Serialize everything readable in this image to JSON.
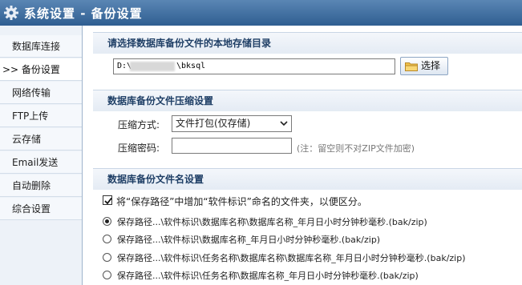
{
  "window": {
    "title": "系统设置 - 备份设置"
  },
  "sidebar": {
    "items": [
      {
        "label": "数据库连接"
      },
      {
        "label": ">> 备份设置"
      },
      {
        "label": "网络传输"
      },
      {
        "label": "FTP上传"
      },
      {
        "label": "云存储"
      },
      {
        "label": "Email发送"
      },
      {
        "label": "自动删除"
      },
      {
        "label": "综合设置"
      }
    ]
  },
  "storage": {
    "heading": "请选择数据库备份文件的本地存储目录",
    "path_prefix": "D:\\",
    "path_suffix": "\\bksql",
    "choose_button": "选择"
  },
  "compression": {
    "heading": "数据库备份文件压缩设置",
    "method_label": "压缩方式:",
    "method_value": "文件打包(仅存储)",
    "password_label": "压缩密码:",
    "password_value": "",
    "password_hint": "(注：留空则不对ZIP文件加密)"
  },
  "filename": {
    "heading": "数据库备份文件名设置",
    "folder_checkbox_label": "将“保存路径”中增加“软件标识”命名的文件夹，以便区分。",
    "folder_checkbox_checked": true,
    "selected_option": 0,
    "options": [
      "保存路径...\\软件标识\\数据库名称\\数据库名称_年月日小时分钟秒毫秒.(bak/zip)",
      "保存路径...\\软件标识\\数据库名称_年月日小时分钟秒毫秒.(bak/zip)",
      "保存路径...\\软件标识\\任务名称\\数据库名称\\数据库名称_年月日小时分钟秒毫秒.(bak/zip)",
      "保存路径...\\软件标识\\任务名称\\数据库名称_年月日小时分钟秒毫秒.(bak/zip)"
    ]
  },
  "colors": {
    "titlebar": "#3d6a9c",
    "section_text": "#1f3f66",
    "sidebar_bg": "#edf2f8"
  },
  "icons": {
    "title": "gear-icon",
    "choose": "folder-icon",
    "select": "chevron-down-icon"
  }
}
